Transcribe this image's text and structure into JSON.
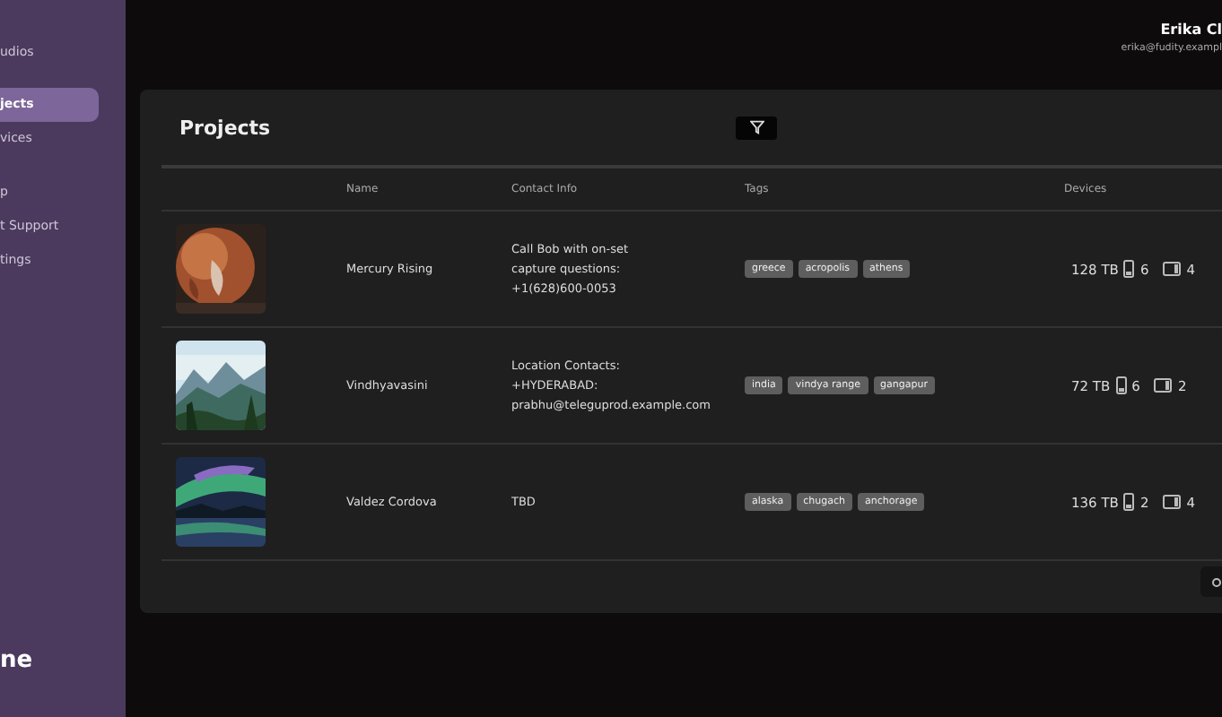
{
  "sidebar": {
    "workspace": "udios",
    "items": [
      {
        "label": "jects",
        "selected": true
      },
      {
        "label": "vices",
        "selected": false
      },
      {
        "label": "p",
        "selected": false
      },
      {
        "label": "t Support",
        "selected": false
      },
      {
        "label": "tings",
        "selected": false
      }
    ],
    "logo": "ne"
  },
  "user": {
    "name": "Erika Cl",
    "email": "erika@fudity.exampl"
  },
  "panel": {
    "title": "Projects",
    "columns": [
      "Name",
      "Contact Info",
      "Tags",
      "Devices"
    ],
    "rows": [
      {
        "name": "Mercury Rising",
        "contact": [
          "Call Bob with on-set",
          "capture questions:",
          "+1(628)600-0053"
        ],
        "tags": [
          "greece",
          "acropolis",
          "athens"
        ],
        "storage": "128 TB",
        "phones": "6",
        "tablets": "4"
      },
      {
        "name": "Vindhyavasini",
        "contact": [
          "Location Contacts:",
          "+HYDERABAD:",
          "prabhu@teleguprod.example.com"
        ],
        "tags": [
          "india",
          "vindya range",
          "gangapur"
        ],
        "storage": "72 TB",
        "phones": "6",
        "tablets": "2"
      },
      {
        "name": "Valdez Cordova",
        "contact": [
          "TBD"
        ],
        "tags": [
          "alaska",
          "chugach",
          "anchorage"
        ],
        "storage": "136 TB",
        "phones": "2",
        "tablets": "4"
      }
    ]
  }
}
